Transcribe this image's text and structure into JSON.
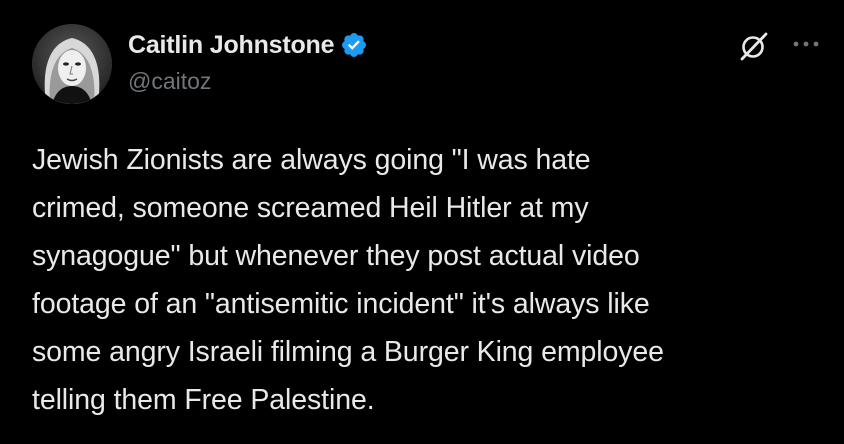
{
  "author": {
    "display_name": "Caitlin Johnstone",
    "handle": "@caitoz",
    "verified": true,
    "avatar_icon": "profile-photo",
    "verified_icon": "verified-badge-icon",
    "badge_color": "#1d9bf0"
  },
  "actions": {
    "grok_icon": "grok-icon",
    "more_icon": "more-options-icon"
  },
  "tweet": {
    "lines": [
      "Jewish Zionists are always going \"I was hate",
      "crimed, someone screamed Heil Hitler at my",
      "synagogue\" but whenever they post actual video",
      "footage of an \"antisemitic incident\" it's always like",
      "some angry Israeli filming a Burger King employee",
      "telling them Free Palestine."
    ]
  },
  "colors": {
    "background": "#000000",
    "text_primary": "#e7e9ea",
    "text_secondary": "#71767b"
  }
}
